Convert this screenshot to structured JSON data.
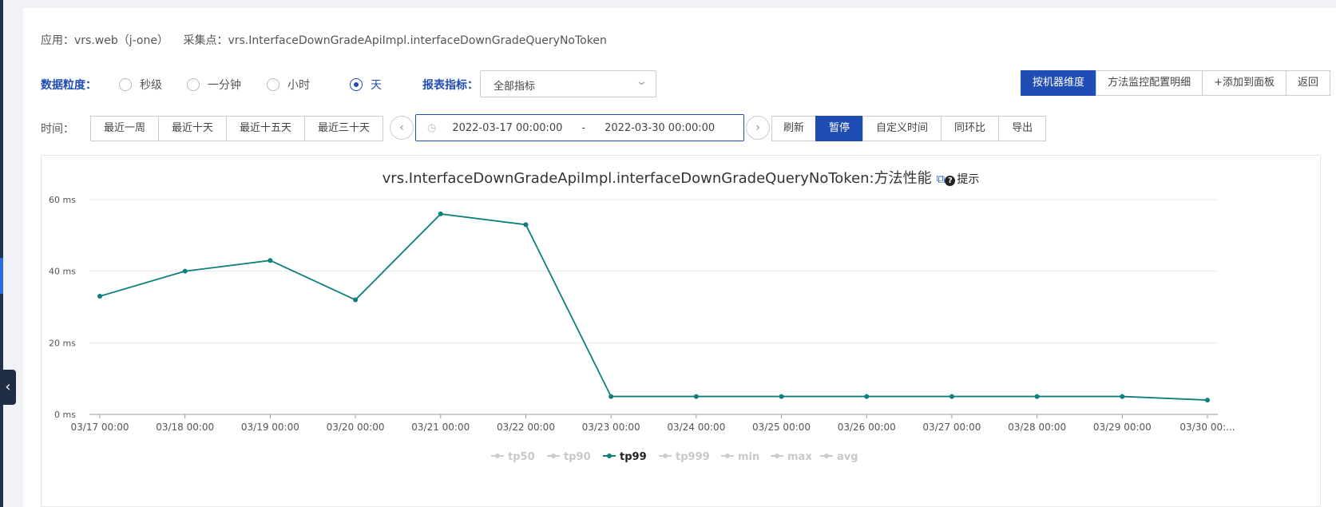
{
  "app": {
    "app_label": "应用：vrs.web（j-one）",
    "collect_label": "采集点：vrs.InterfaceDownGradeApiImpl.interfaceDownGradeQueryNoToken"
  },
  "granularity": {
    "label": "数据粒度：",
    "options": [
      "秒级",
      "一分钟",
      "小时",
      "天"
    ],
    "selected": "天"
  },
  "metric": {
    "label": "报表指标：",
    "value": "全部指标"
  },
  "top_buttons": [
    "按机器维度",
    "方法监控配置明细",
    "+添加到面板",
    "返回"
  ],
  "time": {
    "label": "时间：",
    "quick": [
      "最近一周",
      "最近十天",
      "最近十五天",
      "最近三十天"
    ],
    "start": "2022-03-17 00:00:00",
    "separator": "-",
    "end": "2022-03-30 00:00:00"
  },
  "actions": [
    "刷新",
    "暂停",
    "自定义时间",
    "同环比",
    "导出"
  ],
  "chart_title": "vrs.InterfaceDownGradeApiImpl.interfaceDownGradeQueryNoToken:方法性能",
  "hint_label": "提示",
  "colors": {
    "accent": "#1f4db3",
    "series": "#0e7f7a",
    "legend_inactive": "#cccccc"
  },
  "chart_data": {
    "type": "line",
    "categories": [
      "03/17 00:00",
      "03/18 00:00",
      "03/19 00:00",
      "03/20 00:00",
      "03/21 00:00",
      "03/22 00:00",
      "03/23 00:00",
      "03/24 00:00",
      "03/25 00:00",
      "03/26 00:00",
      "03/27 00:00",
      "03/28 00:00",
      "03/29 00:00",
      "03/30 00:..."
    ],
    "series": [
      {
        "name": "tp99",
        "values": [
          33,
          40,
          43,
          32,
          56,
          53,
          5,
          5,
          5,
          5,
          5,
          5,
          5,
          4
        ]
      }
    ],
    "legend": [
      "tp50",
      "tp90",
      "tp99",
      "tp999",
      "min",
      "max",
      "avg"
    ],
    "legend_active": "tp99",
    "yticks": [
      "0 ms",
      "20 ms",
      "40 ms",
      "60 ms"
    ],
    "ylim": [
      0,
      60
    ],
    "grid": true,
    "legend_position": "bottom"
  }
}
